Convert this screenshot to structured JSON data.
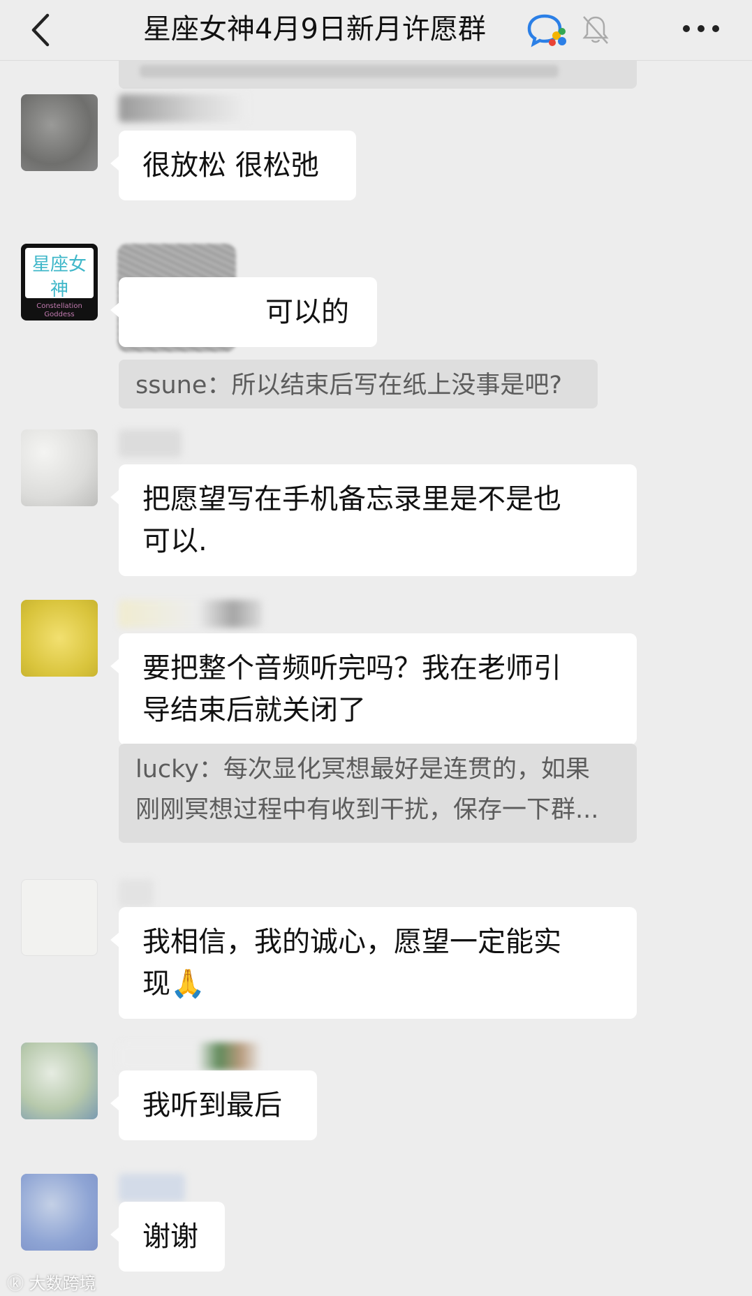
{
  "header": {
    "title": "星座女神4月9日新月许愿群"
  },
  "logo_text": {
    "line1": "星座女神",
    "line2": "Constellation",
    "line3": "Goddess"
  },
  "messages": [
    {
      "bubble": "很放松 很松弛"
    },
    {
      "bubble": "可以的",
      "quote": "ssune：所以结束后写在纸上没事是吧?"
    },
    {
      "bubble": "把愿望写在手机备忘录里是不是也\n可以."
    },
    {
      "bubble": "要把整个音频听完吗？我在老师引\n导结束后就关闭了",
      "quote": "lucky：每次显化冥想最好是连贯的，如果\n刚刚冥想过程中有收到干扰，保存一下群..."
    },
    {
      "bubble": "我相信，我的诚心，愿望一定能实\n现",
      "emoji": "🙏"
    },
    {
      "bubble": "我听到最后"
    },
    {
      "bubble": "谢谢"
    }
  ],
  "watermark": "大数跨境"
}
